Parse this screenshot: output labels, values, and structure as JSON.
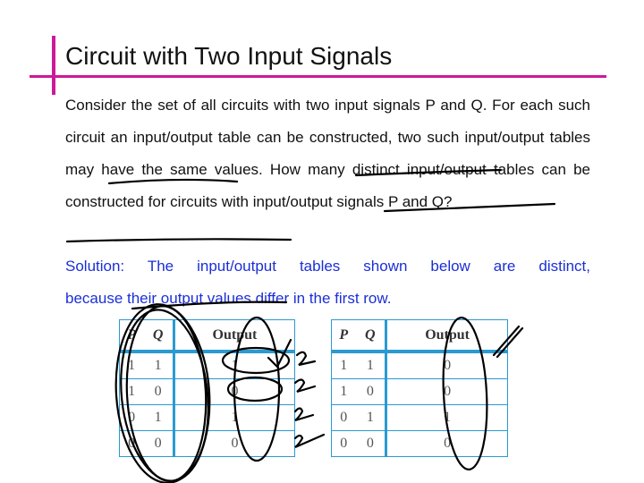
{
  "title": "Circuit with Two Input Signals",
  "paragraph": "Consider the set of all circuits with two input signals P and Q. For each such circuit an input/output table can be constructed, two such input/output tables may have the same values. How many distinct input/output tables can be constructed for circuits with input/output signals P and Q?",
  "solution_line1": "Solution: The input/output tables shown below are distinct,",
  "solution_line2": "because their output values differ in the first row.",
  "accent_color": "#cc1a99",
  "table_border_color": "#2a9ad0",
  "tables": [
    {
      "headers": [
        "P",
        "Q",
        "Output"
      ],
      "rows": [
        [
          "1",
          "1",
          "1"
        ],
        [
          "1",
          "0",
          "0"
        ],
        [
          "0",
          "1",
          "1"
        ],
        [
          "0",
          "0",
          "0"
        ]
      ]
    },
    {
      "headers": [
        "P",
        "Q",
        "Output"
      ],
      "rows": [
        [
          "1",
          "1",
          "0"
        ],
        [
          "1",
          "0",
          "0"
        ],
        [
          "0",
          "1",
          "1"
        ],
        [
          "0",
          "0",
          "0"
        ]
      ]
    }
  ]
}
